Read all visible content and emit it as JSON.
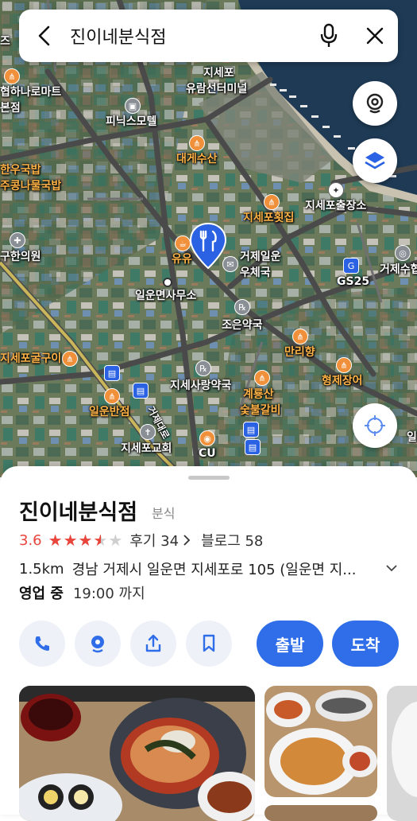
{
  "search": {
    "query": "진이네분식점"
  },
  "map": {
    "labels": {
      "top_left_partial": "즈",
      "jisepo_center": "지세포",
      "jisepo_center2": "유람선터미널",
      "sajeol": "협하나로마트",
      "sajeol2": "본점",
      "phoenix_motel": "피닉스모텔",
      "daege_susan": "대게수산",
      "hanu_gukbap": "한우국밥",
      "kongnamul": "주콩나물국밥",
      "jisepo_hoetjip": "지세포횟집",
      "jisepo_police": "지세포출장소",
      "hanuiwon": "구한의원",
      "yuyu": "유유",
      "post_office": "거제일운",
      "post_office2": "우체국",
      "gs25": "GS25",
      "geoje_partial": "거제수협",
      "ilun_office": "일운면사무소",
      "joeun_pharmacy": "조은약국",
      "manrihyang": "만리향",
      "gulgui": "지세포굴구이",
      "hyeongje": "형제장어",
      "sarang_pharmacy": "지세사랑약국",
      "ilun_banjeom": "일운반점",
      "gyeryongsan": "계룡산",
      "galbi": "숯불갈비",
      "road_name": "거제대로",
      "church": "지세포교회",
      "cu": "CU",
      "right_edge": "일"
    }
  },
  "place": {
    "name": "진이네분식점",
    "category": "분식",
    "rating": "3.6",
    "reviews": "후기 34",
    "blog": "블로그 58",
    "distance": "1.5km",
    "address": "경남 거제시 일운면 지세포로 105 (일운면 지...",
    "status": "영업 중",
    "hours": "19:00 까지"
  },
  "actions": {
    "depart": "출발",
    "arrive": "도착"
  },
  "colors": {
    "primary": "#2f6ee8",
    "rating_red": "#e8453c",
    "marker": "#2b62e3"
  }
}
